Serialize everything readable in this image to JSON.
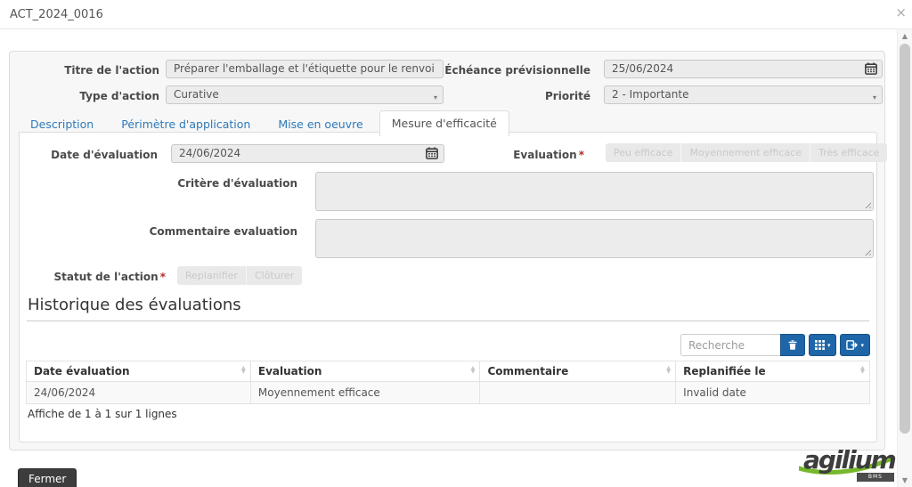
{
  "window": {
    "title": "ACT_2024_0016"
  },
  "icons": {
    "close": "×",
    "caret_down": "▾",
    "sort_up": "▲",
    "sort_down": "▼",
    "scroll_up": "▲",
    "scroll_down": "▼",
    "required": "*"
  },
  "form": {
    "titre_label": "Titre de l'action",
    "titre_value": "Préparer l'emballage et l'étiquette pour le renvoi",
    "echeance_label": "Échéance prévisionnelle",
    "echeance_value": "25/06/2024",
    "type_label": "Type d'action",
    "type_value": "Curative",
    "priorite_label": "Priorité",
    "priorite_value": "2 - Importante"
  },
  "tabs": {
    "items": [
      {
        "label": "Description"
      },
      {
        "label": "Périmètre d'application"
      },
      {
        "label": "Mise en oeuvre"
      },
      {
        "label": "Mesure d'efficacité"
      }
    ],
    "active": "Mesure d'efficacité"
  },
  "efficacite": {
    "date_label": "Date d'évaluation",
    "date_value": "24/06/2024",
    "evaluation_label": "Evaluation",
    "evaluation_buttons": [
      "Peu efficace",
      "Moyennement efficace",
      "Très efficace"
    ],
    "critere_label": "Critère d'évaluation",
    "critere_value": "",
    "commentaire_label": "Commentaire evaluation",
    "commentaire_value": "",
    "statut_label": "Statut de l'action",
    "statut_buttons": [
      "Replanifier",
      "Clôturer"
    ]
  },
  "history": {
    "heading": "Historique des évaluations",
    "search_placeholder": "Recherche",
    "columns": [
      "Date évaluation",
      "Evaluation",
      "Commentaire",
      "Replanifiée le"
    ],
    "rows": [
      [
        "24/06/2024",
        "Moyennement efficace",
        "",
        "Invalid date"
      ]
    ],
    "info": "Affiche de 1 à 1 sur 1 lignes"
  },
  "footer": {
    "close_button": "Fermer",
    "logo_text": "agilium",
    "logo_badge": "BMS"
  },
  "colors": {
    "accent_blue": "#1e66a8",
    "tab_link_blue": "#2e79b9",
    "required_red": "#b52b27",
    "logo_green": "#76b82a",
    "disabled_bg": "#ececec"
  }
}
